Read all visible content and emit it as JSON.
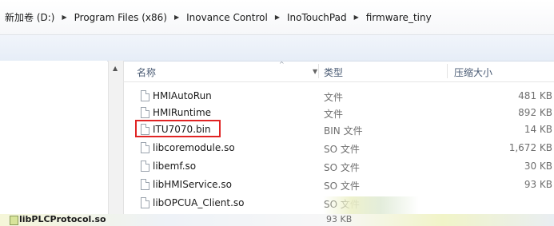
{
  "breadcrumb": [
    "新加卷 (D:)",
    "Program Files (x86)",
    "Inovance Control",
    "InoTouchPad",
    "firmware_tiny"
  ],
  "columns": {
    "name": "名称",
    "type": "类型",
    "size": "压缩大小"
  },
  "files": [
    {
      "name": "HMIAutoRun",
      "type": "文件",
      "size": "481 KB"
    },
    {
      "name": "HMIRuntime",
      "type": "文件",
      "size": "892 KB"
    },
    {
      "name": "ITU7070.bin",
      "type": "BIN 文件",
      "size": "14 KB"
    },
    {
      "name": "libcoremodule.so",
      "type": "SO 文件",
      "size": "1,672 KB"
    },
    {
      "name": "libemf.so",
      "type": "SO 文件",
      "size": "30 KB"
    },
    {
      "name": "libHMIService.so",
      "type": "SO 文件",
      "size": "93 KB"
    },
    {
      "name": "libOPCUA_Client.so",
      "type": "SO 文件",
      "size": ""
    }
  ],
  "partial_row": {
    "name": "libPLCProtocol.so",
    "size": "93 KB"
  },
  "highlight_color": "#e02424"
}
